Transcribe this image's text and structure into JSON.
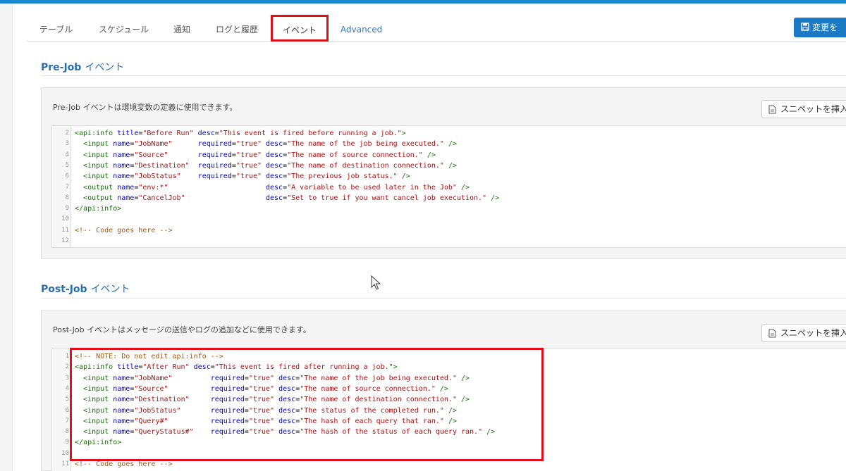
{
  "tabs": [
    {
      "label": "テーブル"
    },
    {
      "label": "スケジュール"
    },
    {
      "label": "通知"
    },
    {
      "label": "ログと履歴"
    },
    {
      "label": "イベント"
    },
    {
      "label": "Advanced"
    }
  ],
  "save_button": {
    "label": "変更を"
  },
  "prejob": {
    "title_en": "Pre-Job",
    "title_jp": "イベント",
    "description": "Pre-Job イベントは環境変数の定義に使用できます。",
    "snippet_label": "スニペットを挿入",
    "lines": [
      {
        "n": "2",
        "text": "<api:info title=\"Before Run\" desc=\"This event is fired before running a job.\">"
      },
      {
        "n": "3",
        "text": "  <input name=\"JobName\"      required=\"true\" desc=\"The name of the job being executed.\" />"
      },
      {
        "n": "4",
        "text": "  <input name=\"Source\"       required=\"true\" desc=\"The name of source connection.\" />"
      },
      {
        "n": "5",
        "text": "  <input name=\"Destination\"  required=\"true\" desc=\"The name of destination connection.\" />"
      },
      {
        "n": "6",
        "text": "  <input name=\"JobStatus\"    required=\"true\" desc=\"The previous job status.\" />"
      },
      {
        "n": "7",
        "text": "  <output name=\"env:*\"                       desc=\"A variable to be used later in the Job\" />"
      },
      {
        "n": "8",
        "text": "  <output name=\"CancelJob\"                   desc=\"Set to true if you want cancel job execution.\" />"
      },
      {
        "n": "9",
        "text": "</api:info>"
      },
      {
        "n": "10",
        "text": ""
      },
      {
        "n": "11",
        "text": "<!-- Code goes here -->"
      },
      {
        "n": "12",
        "text": ""
      }
    ]
  },
  "postjob": {
    "title_en": "Post-Job",
    "title_jp": "イベント",
    "description": "Post-Job イベントはメッセージの送信やログの追加などに使用できます。",
    "snippet_label": "スニペットを挿入",
    "lines": [
      {
        "n": "1",
        "text": "<!-- NOTE: Do not edit api:info -->"
      },
      {
        "n": "2",
        "text": "<api:info title=\"After Run\" desc=\"This event is fired after running a job.\">"
      },
      {
        "n": "3",
        "text": "  <input name=\"JobName\"         required=\"true\" desc=\"The name of the job being executed.\" />"
      },
      {
        "n": "4",
        "text": "  <input name=\"Source\"          required=\"true\" desc=\"The name of source connection.\" />"
      },
      {
        "n": "5",
        "text": "  <input name=\"Destination\"     required=\"true\" desc=\"The name of destination connection.\" />"
      },
      {
        "n": "6",
        "text": "  <input name=\"JobStatus\"       required=\"true\" desc=\"The status of the completed run.\" />"
      },
      {
        "n": "7",
        "text": "  <input name=\"Query#\"          required=\"true\" desc=\"The hash of each query that ran.\" />"
      },
      {
        "n": "8",
        "text": "  <input name=\"QueryStatus#\"    required=\"true\" desc=\"The hash of the status of each query ran.\" />"
      },
      {
        "n": "9",
        "text": "</api:info>"
      },
      {
        "n": "10",
        "text": ""
      },
      {
        "n": "11",
        "text": "<!-- Code goes here -->"
      }
    ]
  },
  "colors": {
    "accent": "#1a87d1",
    "highlight": "#e0101a",
    "section_title": "#2a6eb0"
  }
}
